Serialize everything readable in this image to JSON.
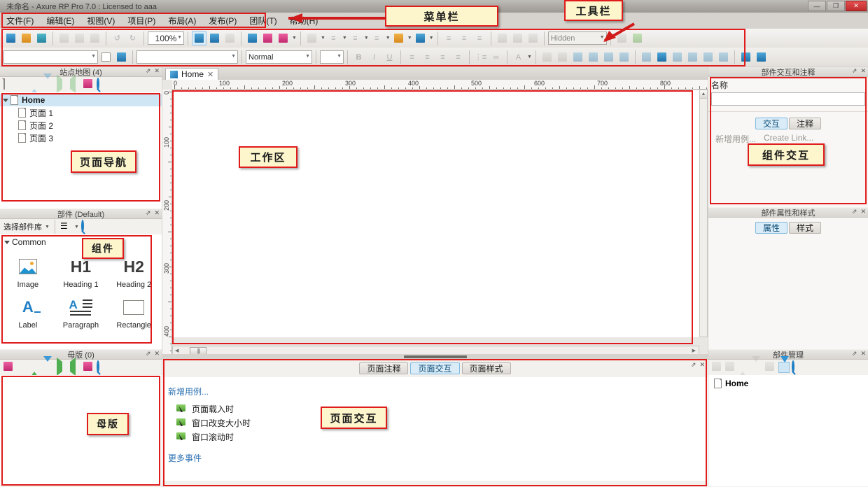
{
  "window": {
    "title": "未命名 - Axure RP Pro 7.0 : Licensed to aaa",
    "minimize": "—",
    "restore": "❐",
    "close": "✕"
  },
  "menubar": {
    "items": [
      {
        "label": "文件(F)"
      },
      {
        "label": "编辑(E)"
      },
      {
        "label": "视图(V)"
      },
      {
        "label": "项目(P)"
      },
      {
        "label": "布局(A)"
      },
      {
        "label": "发布(P)"
      },
      {
        "label": "团队(T)"
      },
      {
        "label": "帮助(H)"
      }
    ]
  },
  "toolbar": {
    "zoom_value": "100%",
    "font_family_value": "",
    "font_size_value": "",
    "style_value": "Normal",
    "hidden_label": "Hidden",
    "bold": "B",
    "italic": "I",
    "underline": "U"
  },
  "sitemap": {
    "title": "站点地图 (4)",
    "tree": [
      {
        "label": "Home",
        "level": 0,
        "selected": true,
        "bold": true
      },
      {
        "label": "页面 1",
        "level": 1,
        "selected": false,
        "bold": false
      },
      {
        "label": "页面 2",
        "level": 1,
        "selected": false,
        "bold": false
      },
      {
        "label": "页面 3",
        "level": 1,
        "selected": false,
        "bold": false
      }
    ]
  },
  "widgets": {
    "title": "部件 (Default)",
    "library_selector": "选择部件库",
    "group": "Common",
    "items": [
      {
        "label": "Image",
        "icon": "image-icon"
      },
      {
        "label": "Heading 1",
        "icon": "h1-icon"
      },
      {
        "label": "Heading 2",
        "icon": "h2-icon"
      },
      {
        "label": "Label",
        "icon": "label-icon"
      },
      {
        "label": "Paragraph",
        "icon": "paragraph-icon"
      },
      {
        "label": "Rectangle",
        "icon": "rectangle-icon"
      }
    ]
  },
  "masters": {
    "title": "母版 (0)"
  },
  "canvas": {
    "tab_label": "Home",
    "tab_close": "✕",
    "ruler_h": [
      "0",
      "100",
      "200",
      "300",
      "400",
      "500",
      "600",
      "700",
      "800"
    ],
    "ruler_v": [
      "0",
      "100",
      "200",
      "300",
      "400"
    ]
  },
  "page_panel": {
    "tabs": [
      {
        "label": "页面注释",
        "active": false
      },
      {
        "label": "页面交互",
        "active": true
      },
      {
        "label": "页面样式",
        "active": false
      }
    ],
    "new_case": "新增用例...",
    "events": [
      {
        "label": "页面载入时"
      },
      {
        "label": "窗口改变大小时"
      },
      {
        "label": "窗口滚动时"
      }
    ],
    "more_events": "更多事件"
  },
  "widget_interactions": {
    "title": "部件交互和注释",
    "name_label": "名称",
    "name_value": "",
    "tabs": [
      {
        "label": "交互",
        "active": true
      },
      {
        "label": "注释",
        "active": false
      }
    ],
    "new_case": "新增用例...",
    "create_link": "Create Link..."
  },
  "widget_properties": {
    "title": "部件属性和样式",
    "tabs": [
      {
        "label": "属性",
        "active": true
      },
      {
        "label": "样式",
        "active": false
      }
    ]
  },
  "widget_manager": {
    "title": "部件管理",
    "items": [
      {
        "label": "Home"
      }
    ]
  },
  "annotations": [
    {
      "id": "menubar-callout",
      "label": "菜单栏"
    },
    {
      "id": "toolbar-callout",
      "label": "工具栏"
    },
    {
      "id": "page-nav-callout",
      "label": "页面导航"
    },
    {
      "id": "components-callout",
      "label": "组件"
    },
    {
      "id": "masters-callout",
      "label": "母版"
    },
    {
      "id": "workspace-callout",
      "label": "工作区"
    },
    {
      "id": "page-interaction-callout",
      "label": "页面交互"
    },
    {
      "id": "component-interaction-callout",
      "label": "组件交互"
    }
  ],
  "colors": {
    "annotation_red": "#e01b1b",
    "callout_bg": "#fdf6cd",
    "accent_blue": "#1f7fc4",
    "selection_blue": "#cfe7f5"
  }
}
